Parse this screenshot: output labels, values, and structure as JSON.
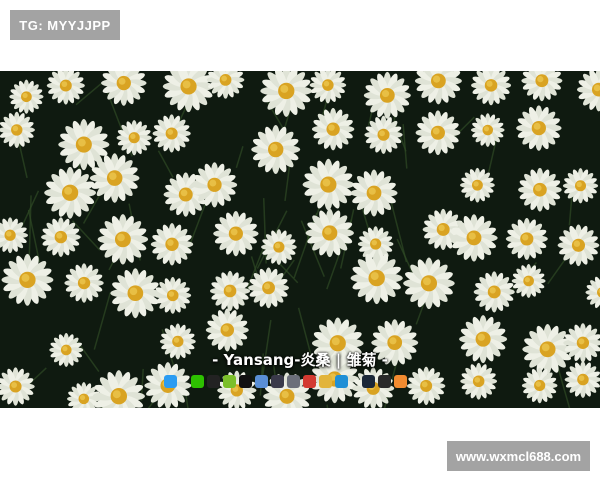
{
  "tag": {
    "text": "TG: MYYJJPP"
  },
  "wallpaper": {
    "subject": "white daisies with yellow centers",
    "caption": "- Yansang-炎桑 | 雏菊 -"
  },
  "taskbar": {
    "icons": [
      {
        "name": "windows-start-icon",
        "color": "#2b9cf2"
      },
      {
        "name": "wechat-icon",
        "color": "#2dc100"
      },
      {
        "name": "qq-icon",
        "color": "#222222"
      },
      {
        "name": "green-app-icon",
        "color": "#7bbf2a"
      },
      {
        "name": "capcut-icon",
        "color": "#111111"
      },
      {
        "name": "screen-capture-icon",
        "color": "#5a8fd6"
      },
      {
        "name": "obs-icon",
        "color": "#3a3a4a"
      },
      {
        "name": "files-icon",
        "color": "#6b6f7a"
      },
      {
        "name": "netease-music-icon",
        "color": "#d33a31"
      },
      {
        "name": "folder-icon",
        "color": "#e2b43a"
      },
      {
        "name": "edge-icon",
        "color": "#1f8fd6"
      },
      {
        "name": "steam-icon",
        "color": "#1b2838"
      },
      {
        "name": "epic-games-icon",
        "color": "#2a2a2a"
      },
      {
        "name": "colorful-app-icon",
        "color": "#f28b30"
      }
    ]
  },
  "watermark": {
    "text": "www.wxmcl688.com"
  }
}
